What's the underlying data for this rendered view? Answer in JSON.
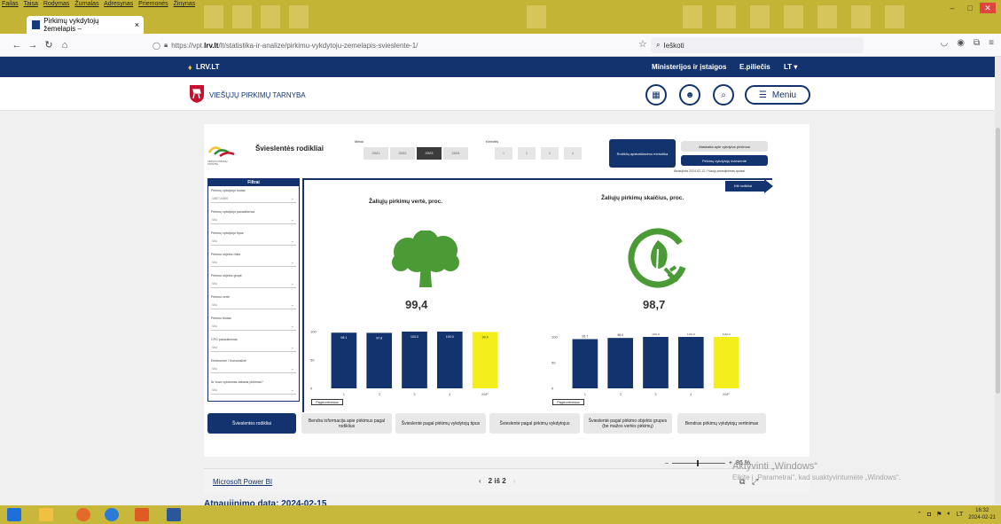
{
  "browser": {
    "menu": [
      "Failas",
      "Taisa",
      "Rodymas",
      "Žurnalas",
      "Adresynas",
      "Priemonės",
      "Žinynas"
    ],
    "tab_title": "Pirkimų vykdytojų žemelapis – ",
    "tab_close": "×",
    "url_prefix": "https://vpt.",
    "url_domain": "lrv.lt",
    "url_rest": "/lt/statistika-ir-analize/pirkimu-vykdytoju-zemelapis-svieslente-1/",
    "search_placeholder": "Ieškoti"
  },
  "site": {
    "topbar_logo": "LRV.LT",
    "topbar_links": [
      "Ministerijos ir įstaigos",
      "E.piliečis",
      "LT"
    ],
    "org_name": "VIEŠŲJŲ PIRKIMŲ TARNYBA",
    "menu_label": "Meniu"
  },
  "report": {
    "title": "Švieslentės rodikliai",
    "logo_caption": "VIEŠŲJŲ PIRKIMŲ TARNYBA",
    "year_label": "Metai",
    "years": [
      "2021",
      "2022",
      "2023",
      "2024"
    ],
    "active_year": "2023",
    "quarter_label": "Ketvirtis",
    "quarters": [
      "1",
      "2",
      "3",
      "4"
    ],
    "btn_method": "Rodiklių apskaičiavimo metodika",
    "btn_report": "Ataskaita apie vykdytus pirkimus",
    "btn_map": "Pirkimų vykdytojų švieslentė",
    "updated_note": "Atnaujinta 2024-02-12 / Naujų atnaujinimas tęsiasi",
    "filters_title": "Filtrai",
    "filters": [
      {
        "label": "Pirkimų vykdytojo kodas",
        "value": "188714469"
      },
      {
        "label": "Pirkimų vykdytojo pavadinimas",
        "value": "Visi"
      },
      {
        "label": "Pirkimų vykdytojo tipas",
        "value": "Visi"
      },
      {
        "label": "Pirkimo objekto rūšis",
        "value": "Visi"
      },
      {
        "label": "Pirkimo objekto grupė",
        "value": "Visi"
      },
      {
        "label": "Pirkimo vertė",
        "value": "Visi"
      },
      {
        "label": "Pirkimo būdas",
        "value": "Visi"
      },
      {
        "label": "CPO pasaulinimas",
        "value": "Visi"
      },
      {
        "label": "Elektroninė / Komunalinė",
        "value": "Visi"
      },
      {
        "label": "Ar buvo vykdomas žaliasis pirkimas?",
        "value": "Visi"
      }
    ],
    "next_btn": "Kiti rodikliai",
    "left": {
      "title": "Žaliųjų pirkimų vertė, proc.",
      "kpi": "99,4",
      "month_btn": "Pagal mėnesius",
      "bar_color": "#12336e",
      "highlight_color": "#f4ef1c",
      "icon_color": "#4a9a36"
    },
    "right": {
      "title": "Žaliųjų pirkimų skaičius, proc.",
      "kpi": "98,7",
      "month_btn": "Pagal mėnesius"
    },
    "tabs": [
      "Švieslentės rodikliai",
      "Bendra informacija apie pirkimus pagal rodiklius",
      "Švieslentė pagal pirkimų vykdytojų tipus",
      "Švieslentė pagal pirkimų vykdytojus",
      "Švieslentė pagal pirkimo objekto grupes (be mažos vertės pirkimų)",
      "Bendras pirkimų vykdytojų vertinimas"
    ]
  },
  "chart_data": [
    {
      "type": "bar",
      "categories": [
        "1",
        "2",
        "3",
        "4",
        "KVP"
      ],
      "values": [
        98.1,
        97.8,
        100.0,
        100.0,
        99.4
      ],
      "ylim": [
        0,
        100
      ],
      "yticks": [
        "0",
        "50",
        "100"
      ]
    },
    {
      "type": "bar",
      "categories": [
        "1",
        "2",
        "3",
        "4",
        "KVP"
      ],
      "values": [
        95.7,
        98.0,
        100.0,
        100.0,
        100.0
      ],
      "ylim": [
        0,
        100
      ],
      "yticks": [
        "0",
        "50",
        "100"
      ]
    }
  ],
  "powerbi": {
    "link": "Microsoft Power BI",
    "page": "2 iš 2",
    "zoom": "86 %"
  },
  "windows": {
    "watermark": "Aktyvinti „Windows“",
    "watermark_sub": "Eikite į „Parametrai“, kad suaktyvintumėte „Windows“.",
    "lang": "LT",
    "time": "16:32",
    "date": "2024-02-21"
  },
  "page_update": "Atnaujinimo data: 2024-02-15"
}
